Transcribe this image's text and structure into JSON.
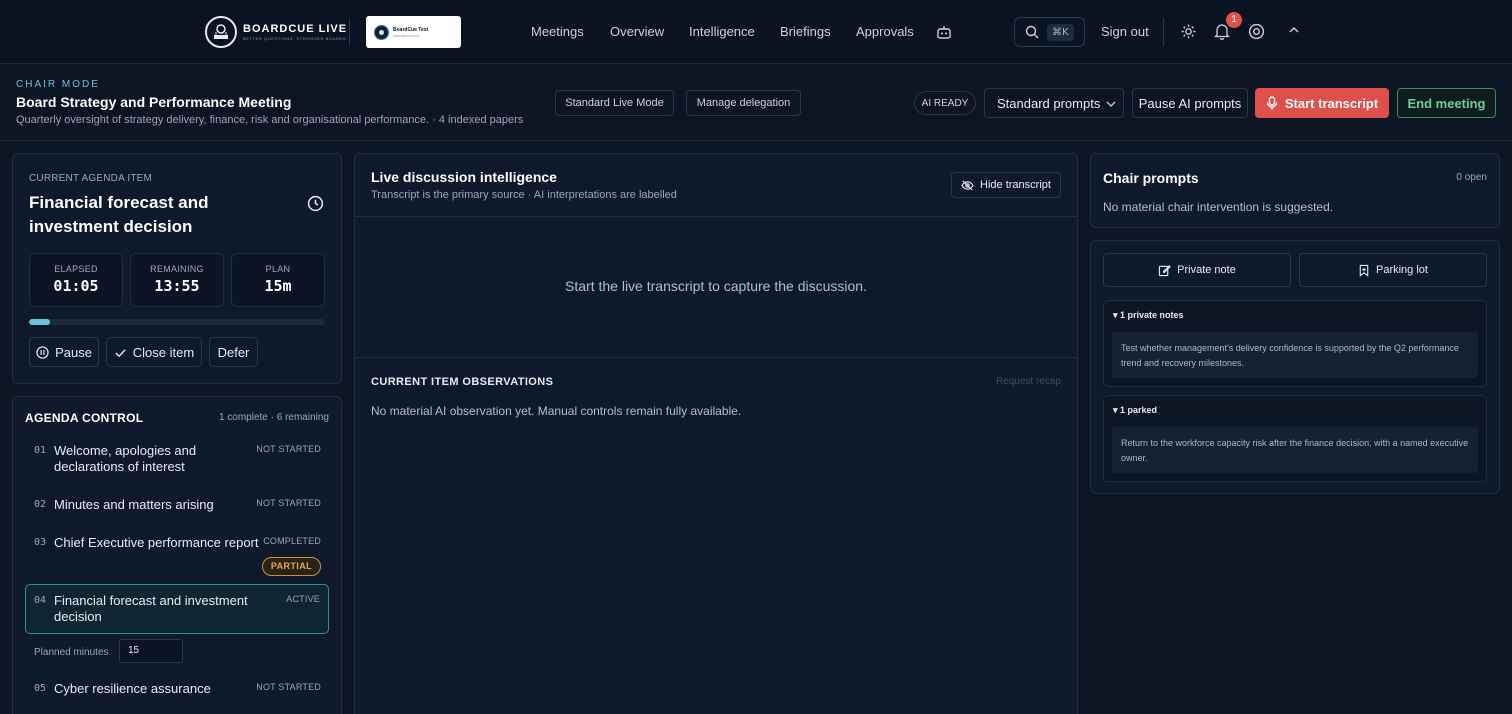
{
  "nav": {
    "logo_title": "BOARDCUE LIVE",
    "logo_tagline": "BETTER QUESTIONS. STRONGER BOARDS.",
    "org_name": "BoardCue Test",
    "org_sub": "ORGANISATION",
    "links": [
      "Meetings",
      "Overview",
      "Intelligence",
      "Briefings",
      "Approvals"
    ],
    "search_shortcut": "⌘K",
    "signout": "Sign out",
    "notification_count": "1",
    "icons": [
      "robot-icon",
      "search-icon",
      "gear-icon",
      "bell-icon",
      "help-icon",
      "chevron-up-icon"
    ]
  },
  "header": {
    "mode": "CHAIR MODE",
    "title": "Board Strategy and Performance Meeting",
    "subtitle": "Quarterly oversight of strategy delivery, finance, risk and organisational performance. · 4 indexed papers",
    "mode_button": "Standard Live Mode",
    "delegation_button": "Manage delegation",
    "ai_status": "AI READY",
    "prompts_select": "Standard prompts",
    "pause_ai": "Pause AI prompts",
    "start_transcript": "Start transcript",
    "end_meeting": "End meeting"
  },
  "current_item": {
    "label": "CURRENT AGENDA ITEM",
    "title": "Financial forecast and investment decision",
    "elapsed_label": "ELAPSED",
    "elapsed": "01:05",
    "remaining_label": "REMAINING",
    "remaining": "13:55",
    "plan_label": "PLAN",
    "plan": "15m",
    "progress_fraction": 0.07,
    "pause": "Pause",
    "close": "Close item",
    "defer": "Defer"
  },
  "agenda_control": {
    "title": "AGENDA CONTROL",
    "summary": "1 complete · 6 remaining",
    "items": [
      {
        "num": "01",
        "title": "Welcome, apologies and declarations of interest",
        "status": "NOT STARTED"
      },
      {
        "num": "02",
        "title": "Minutes and matters arising",
        "status": "NOT STARTED"
      },
      {
        "num": "03",
        "title": "Chief Executive performance report",
        "status": "COMPLETED",
        "badge": "PARTIAL"
      },
      {
        "num": "04",
        "title": "Financial forecast and investment decision",
        "status": "ACTIVE"
      },
      {
        "num": "05",
        "title": "Cyber resilience assurance",
        "status": "NOT STARTED"
      }
    ],
    "planned_label": "Planned minutes",
    "planned_value": "15"
  },
  "live": {
    "title": "Live discussion intelligence",
    "subtitle": "Transcript is the primary source · AI interpretations are labelled",
    "hide_transcript": "Hide transcript",
    "empty": "Start the live transcript to capture the discussion.",
    "observations_title": "CURRENT ITEM OBSERVATIONS",
    "request_recap": "Request recap",
    "observations_text": "No material AI observation yet. Manual controls remain fully available."
  },
  "chair": {
    "title": "Chair prompts",
    "count": "0 open",
    "text": "No material chair intervention is suggested."
  },
  "notes": {
    "private_note_button": "Private note",
    "parking_lot_button": "Parking lot",
    "private_head": "▾ 1 private notes",
    "private_body": "Test whether management's delivery confidence is supported by the Q2 performance trend and recovery milestones.",
    "parked_head": "▾ 1 parked",
    "parked_body": "Return to the workforce capacity risk after the finance decision, with a named executive owner."
  },
  "colors": {
    "accent": "#6cc4d4",
    "danger": "#df4f4b",
    "success": "#6fce8f",
    "warning": "#e5a64a"
  }
}
